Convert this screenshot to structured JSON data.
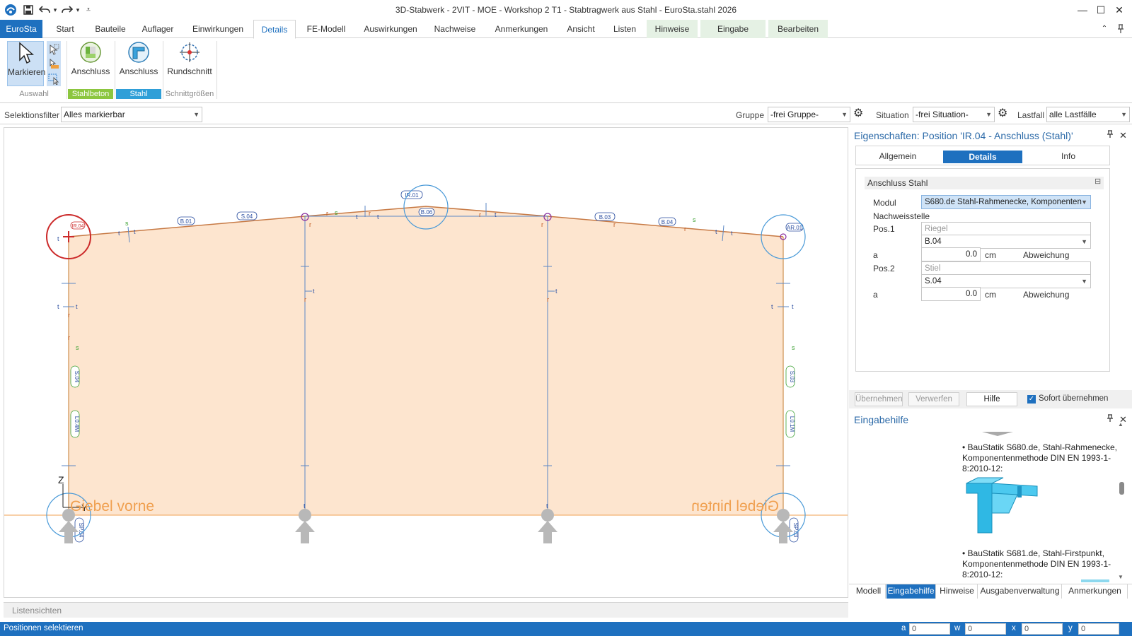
{
  "window": {
    "title": "3D-Stabwerk - 2VIT - MOE - Workshop 2 T1 - Stabtragwerk aus Stahl - EuroSta.stahl 2026",
    "minimize": "—",
    "maximize": "☐",
    "close": "✕"
  },
  "quick_access": {
    "app_icon": "app-logo-icon",
    "save": "💾",
    "undo": "↶",
    "redo": "↷",
    "more": "▾"
  },
  "ribbon_tabs": [
    {
      "label": "EuroSta"
    },
    {
      "label": "Start"
    },
    {
      "label": "Bauteile"
    },
    {
      "label": "Auflager"
    },
    {
      "label": "Einwirkungen"
    },
    {
      "label": "Details"
    },
    {
      "label": "FE-Modell"
    },
    {
      "label": "Auswirkungen"
    },
    {
      "label": "Nachweise"
    },
    {
      "label": "Anmerkungen"
    },
    {
      "label": "Ansicht"
    },
    {
      "label": "Listen"
    },
    {
      "label": "Hinweise"
    },
    {
      "label": "Eingabe"
    },
    {
      "label": "Bearbeiten"
    }
  ],
  "ribbon": {
    "markieren": "Markieren",
    "auswahl": "Auswahl",
    "anschluss_beton": "Anschluss",
    "stahlbeton": "Stahlbeton",
    "anschluss_stahl": "Anschluss",
    "stahl": "Stahl",
    "rundschnitt": "Rundschnitt",
    "schnittgroessen": "Schnittgrößen",
    "colors": {
      "stahlbeton": "#8cc63f",
      "stahl": "#2f9fd8"
    }
  },
  "filterbar": {
    "selektionsfilter_label": "Selektionsfilter",
    "selektionsfilter_value": "Alles markierbar",
    "gruppe_label": "Gruppe",
    "gruppe_value": "-frei Gruppe-",
    "situation_label": "Situation",
    "situation_value": "-frei Situation-",
    "lastfall_label": "Lastfall",
    "lastfall_value": "alle Lastfälle"
  },
  "canvas": {
    "axis_z": "Z",
    "axis_y": "Y",
    "label_left": "Giebel vorne",
    "label_right": "Giebel hinten",
    "tags": {
      "ir04": "IR.04",
      "s04_top": "S.04",
      "b01": "B.01",
      "ir01": "IR.01",
      "b06": "B.06",
      "b03": "B.03",
      "b04": "B.04",
      "ar01": "AR.01",
      "s04_left": "S.04",
      "l04": "L0.4M",
      "s03_right": "S.03",
      "l01": "L0.1M",
      "sp04": "SP.04",
      "sp03": "SP.03"
    },
    "colors": {
      "fill": "#fde5cf",
      "frame": "#5b87c4",
      "selection": "#cc2a2a",
      "label": "#f08c30"
    }
  },
  "properties": {
    "title": "Eigenschaften: Position 'IR.04 - Anschluss (Stahl)'",
    "tabs": [
      "Allgemein",
      "Details",
      "Info"
    ],
    "section": "Anschluss Stahl",
    "modul_label": "Modul",
    "modul_value": "S680.de Stahl-Rahmenecke, Komponenten",
    "nachweisstelle": "Nachweisstelle",
    "pos1_label": "Pos.1",
    "pos1_type": "Riegel",
    "pos1_value": "B.04",
    "a1_label": "a",
    "a1_value": "0.0",
    "a1_unit": "cm",
    "a1_dev": "Abweichung",
    "pos2_label": "Pos.2",
    "pos2_type": "Stiel",
    "pos2_value": "S.04",
    "a2_label": "a",
    "a2_value": "0.0",
    "a2_unit": "cm",
    "a2_dev": "Abweichung"
  },
  "actions": {
    "uebernehmen": "Übernehmen",
    "verwerfen": "Verwerfen",
    "hilfe": "Hilfe",
    "sofort": "Sofort übernehmen"
  },
  "help": {
    "title": "Eingabehilfe",
    "item1": "• BauStatik S680.de, Stahl-Rahmenecke, Komponentenmethode DIN EN 1993-1-8:2010-12:",
    "item2": "• BauStatik S681.de, Stahl-Firstpunkt, Komponentenmethode DIN EN 1993-1-8:2010-12:"
  },
  "bottom_tabs": [
    "Modell",
    "Eingabehilfe",
    "Hinweise",
    "Ausgabenverwaltung",
    "Anmerkungen"
  ],
  "listensichten": "Listensichten",
  "status": {
    "message": "Positionen selektieren",
    "a_label": "a",
    "a_value": "0",
    "w_label": "w",
    "w_value": "0",
    "x_label": "x",
    "x_value": "0",
    "y_label": "y",
    "y_value": "0"
  }
}
